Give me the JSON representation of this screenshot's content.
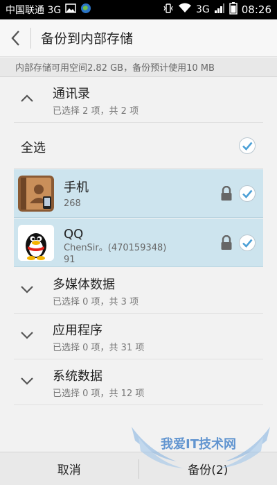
{
  "statusbar": {
    "carrier": "中国联通 3G",
    "network": "3G",
    "time": "08:26"
  },
  "actionbar": {
    "title": "备份到内部存储"
  },
  "info": {
    "text": "内部存储可用空间2.82 GB，备份预计使用10 MB"
  },
  "groups": [
    {
      "title": "通讯录",
      "subtitle": "已选择 2 项，共 2 项",
      "expanded": true
    },
    {
      "title": "多媒体数据",
      "subtitle": "已选择 0 项，共 3 项",
      "expanded": false
    },
    {
      "title": "应用程序",
      "subtitle": "已选择 0 项，共 31 项",
      "expanded": false
    },
    {
      "title": "系统数据",
      "subtitle": "已选择 0 项，共 12 项",
      "expanded": false
    }
  ],
  "select_all": {
    "label": "全选"
  },
  "contacts": [
    {
      "name": "手机",
      "lines": [
        "268"
      ]
    },
    {
      "name": "QQ",
      "lines": [
        "ChenSir。(470159348)",
        "91"
      ]
    }
  ],
  "bottom": {
    "cancel": "取消",
    "backup": "备份(2)"
  },
  "watermark": {
    "text": "我爱IT技术网"
  },
  "colors": {
    "selected_row": "#cde4ee",
    "check_blue": "#4a9fd6"
  }
}
